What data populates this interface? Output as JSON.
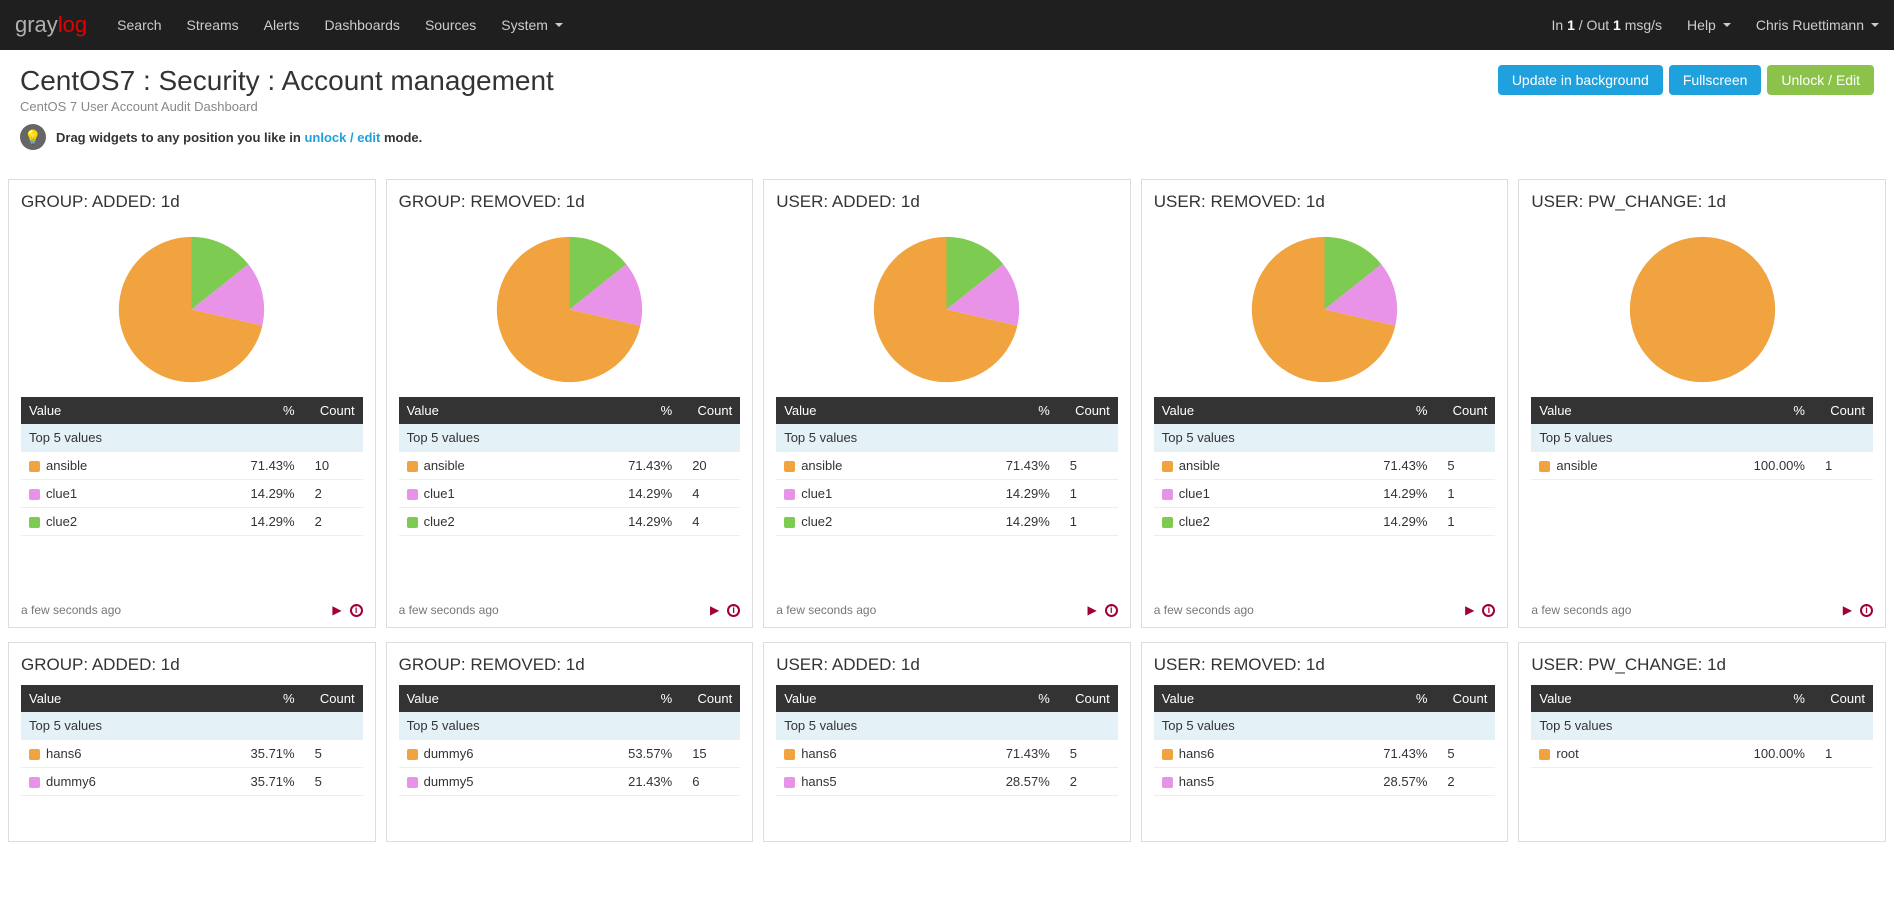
{
  "nav": {
    "items": [
      "Search",
      "Streams",
      "Alerts",
      "Dashboards",
      "Sources",
      "System"
    ],
    "system_has_caret": true,
    "throughput_prefix": "In ",
    "throughput_in": "1",
    "throughput_mid": " / Out ",
    "throughput_out": "1",
    "throughput_suffix": " msg/s",
    "help": "Help",
    "user": "Chris Ruettimann"
  },
  "header": {
    "title": "CentOS7 : Security : Account management",
    "subtitle": "CentOS 7 User Account Audit Dashboard",
    "btn_update": "Update in background",
    "btn_fullscreen": "Fullscreen",
    "btn_unlock": "Unlock / Edit"
  },
  "hint": {
    "prefix": "Drag widgets to any position you like in ",
    "link": "unlock / edit",
    "suffix": " mode."
  },
  "table_headers": {
    "value": "Value",
    "percent": "%",
    "count": "Count",
    "top5": "Top 5 values"
  },
  "footer_time": "a few seconds ago",
  "colors": {
    "orange": "#f0a33f",
    "pink": "#e892e8",
    "green": "#7dcb50"
  },
  "chart_data": [
    {
      "title": "GROUP: ADDED: 1d",
      "type": "pie",
      "series": [
        {
          "name": "ansible",
          "pct": "71.43%",
          "count": "10",
          "color": "orange",
          "value": 71.43
        },
        {
          "name": "clue1",
          "pct": "14.29%",
          "count": "2",
          "color": "pink",
          "value": 14.29
        },
        {
          "name": "clue2",
          "pct": "14.29%",
          "count": "2",
          "color": "green",
          "value": 14.29
        }
      ]
    },
    {
      "title": "GROUP: REMOVED: 1d",
      "type": "pie",
      "series": [
        {
          "name": "ansible",
          "pct": "71.43%",
          "count": "20",
          "color": "orange",
          "value": 71.43
        },
        {
          "name": "clue1",
          "pct": "14.29%",
          "count": "4",
          "color": "pink",
          "value": 14.29
        },
        {
          "name": "clue2",
          "pct": "14.29%",
          "count": "4",
          "color": "green",
          "value": 14.29
        }
      ]
    },
    {
      "title": "USER: ADDED: 1d",
      "type": "pie",
      "series": [
        {
          "name": "ansible",
          "pct": "71.43%",
          "count": "5",
          "color": "orange",
          "value": 71.43
        },
        {
          "name": "clue1",
          "pct": "14.29%",
          "count": "1",
          "color": "pink",
          "value": 14.29
        },
        {
          "name": "clue2",
          "pct": "14.29%",
          "count": "1",
          "color": "green",
          "value": 14.29
        }
      ]
    },
    {
      "title": "USER: REMOVED: 1d",
      "type": "pie",
      "series": [
        {
          "name": "ansible",
          "pct": "71.43%",
          "count": "5",
          "color": "orange",
          "value": 71.43
        },
        {
          "name": "clue1",
          "pct": "14.29%",
          "count": "1",
          "color": "pink",
          "value": 14.29
        },
        {
          "name": "clue2",
          "pct": "14.29%",
          "count": "1",
          "color": "green",
          "value": 14.29
        }
      ]
    },
    {
      "title": "USER: PW_CHANGE: 1d",
      "type": "pie",
      "series": [
        {
          "name": "ansible",
          "pct": "100.00%",
          "count": "1",
          "color": "orange",
          "value": 100.0
        }
      ]
    }
  ],
  "widgets_row2": [
    {
      "title": "GROUP: ADDED: 1d",
      "rows": [
        {
          "name": "hans6",
          "pct": "35.71%",
          "count": "5",
          "color": "orange"
        },
        {
          "name": "dummy6",
          "pct": "35.71%",
          "count": "5",
          "color": "pink"
        }
      ]
    },
    {
      "title": "GROUP: REMOVED: 1d",
      "rows": [
        {
          "name": "dummy6",
          "pct": "53.57%",
          "count": "15",
          "color": "orange"
        },
        {
          "name": "dummy5",
          "pct": "21.43%",
          "count": "6",
          "color": "pink"
        }
      ]
    },
    {
      "title": "USER: ADDED: 1d",
      "rows": [
        {
          "name": "hans6",
          "pct": "71.43%",
          "count": "5",
          "color": "orange"
        },
        {
          "name": "hans5",
          "pct": "28.57%",
          "count": "2",
          "color": "pink"
        }
      ]
    },
    {
      "title": "USER: REMOVED: 1d",
      "rows": [
        {
          "name": "hans6",
          "pct": "71.43%",
          "count": "5",
          "color": "orange"
        },
        {
          "name": "hans5",
          "pct": "28.57%",
          "count": "2",
          "color": "pink"
        }
      ]
    },
    {
      "title": "USER: PW_CHANGE: 1d",
      "rows": [
        {
          "name": "root",
          "pct": "100.00%",
          "count": "1",
          "color": "orange"
        }
      ]
    }
  ]
}
